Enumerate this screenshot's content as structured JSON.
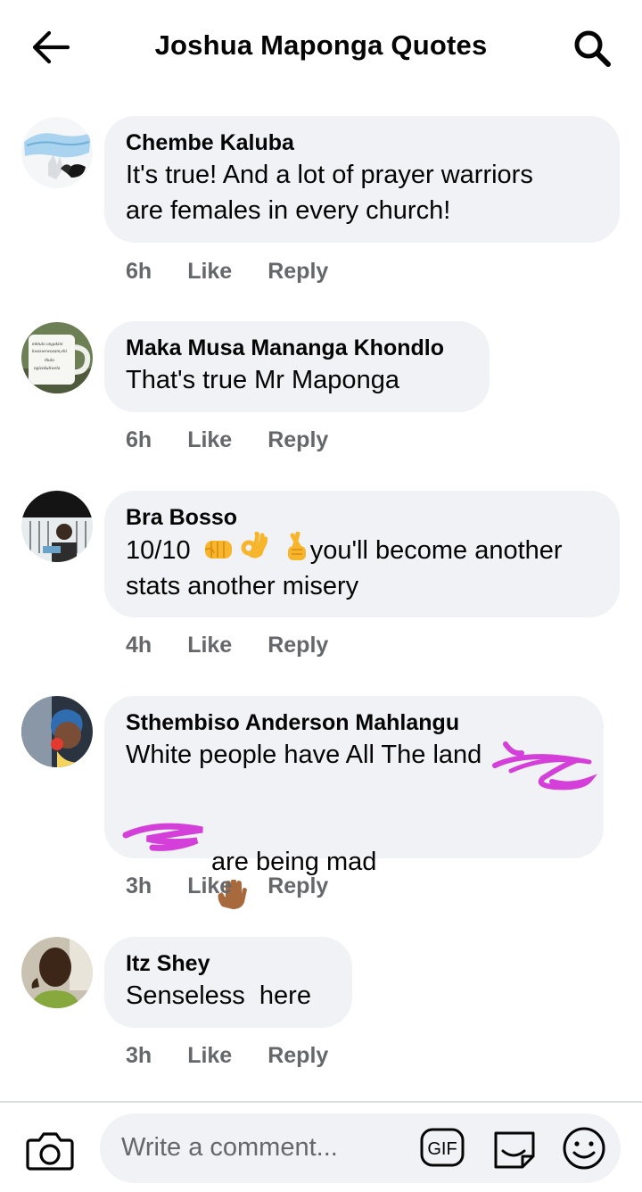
{
  "header": {
    "title": "Joshua Maponga Quotes",
    "back_icon": "arrow-left-icon",
    "search_icon": "search-icon"
  },
  "comments": [
    {
      "author": "Chembe Kaluba",
      "text": "It's true! And a lot of prayer warriors\nare females in every church!",
      "time": "6h",
      "like": "Like",
      "reply": "Reply",
      "avatar": "face-mask-photo"
    },
    {
      "author": "Maka Musa Mananga Khondlo",
      "text": "That's true Mr Maponga",
      "time": "6h",
      "like": "Like",
      "reply": "Reply",
      "avatar": "mug-photo",
      "avatar_text": [
        "mhtulo ongakini",
        "kwaswewazam,ehi",
        "thula",
        "ngizokuliwela"
      ]
    },
    {
      "author": "Bra Bosso",
      "text_before": "10/10",
      "emojis": [
        "oncoming-fist",
        "ok-hand",
        "crossed-fingers"
      ],
      "text_after": "you'll become another\nstats another misery",
      "time": "4h",
      "like": "Like",
      "reply": "Reply",
      "avatar": "man-at-window-photo"
    },
    {
      "author": "Sthembiso Anderson Mahlangu",
      "line1": "White people have All The land",
      "line3": "are being mad",
      "emoji": "raised-hand-medium-dark",
      "scribble_color": "#d43fd9",
      "time": "3h",
      "like": "Like",
      "reply": "Reply",
      "avatar": "child-photo"
    },
    {
      "author": "Itz Shey",
      "text": "Senseless  here",
      "time": "3h",
      "like": "Like",
      "reply": "Reply",
      "avatar": "man-selfie-photo"
    }
  ],
  "composer": {
    "placeholder": "Write a comment...",
    "camera_icon": "camera-icon",
    "gif_label": "GIF",
    "sticker_icon": "sticker-icon",
    "emoji_icon": "smiley-icon"
  },
  "colors": {
    "bubble": "#f0f2f5",
    "meta": "#65676b",
    "text": "#050505",
    "scribble": "#d43fd9"
  }
}
